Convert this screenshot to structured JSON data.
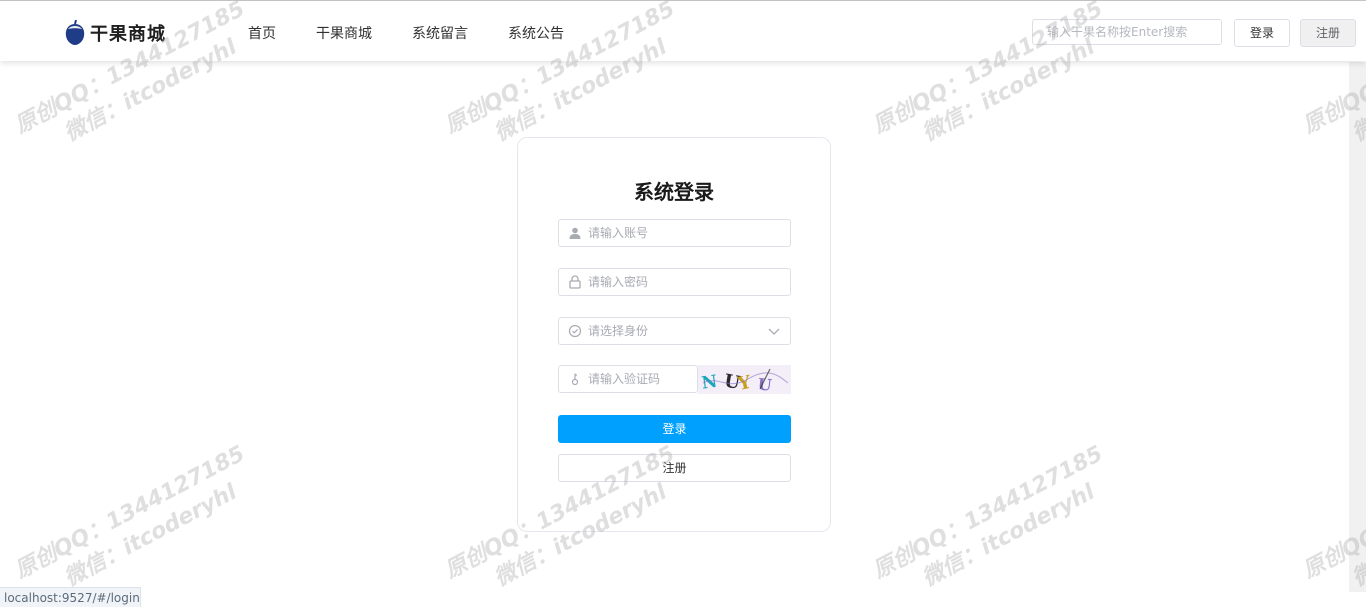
{
  "header": {
    "logo_text": "干果商城",
    "nav": [
      "首页",
      "干果商城",
      "系统留言",
      "系统公告"
    ],
    "search_placeholder": "输入干果名称按Enter搜索",
    "login_label": "登录",
    "register_label": "注册"
  },
  "login_form": {
    "title": "系统登录",
    "account_placeholder": "请输入账号",
    "password_placeholder": "请输入密码",
    "role_placeholder": "请选择身份",
    "captcha_placeholder": "请输入验证码",
    "captcha_text": "NUYU",
    "login_button": "登录",
    "register_button": "注册"
  },
  "watermark": {
    "line1": "原创QQ：1344127185",
    "line2": "微信：itcoderyhl"
  },
  "status_url": "localhost:9527/#/login",
  "colors": {
    "primary": "#00a0ff",
    "border": "#dcdfe6",
    "logo": "#1f3c88"
  }
}
